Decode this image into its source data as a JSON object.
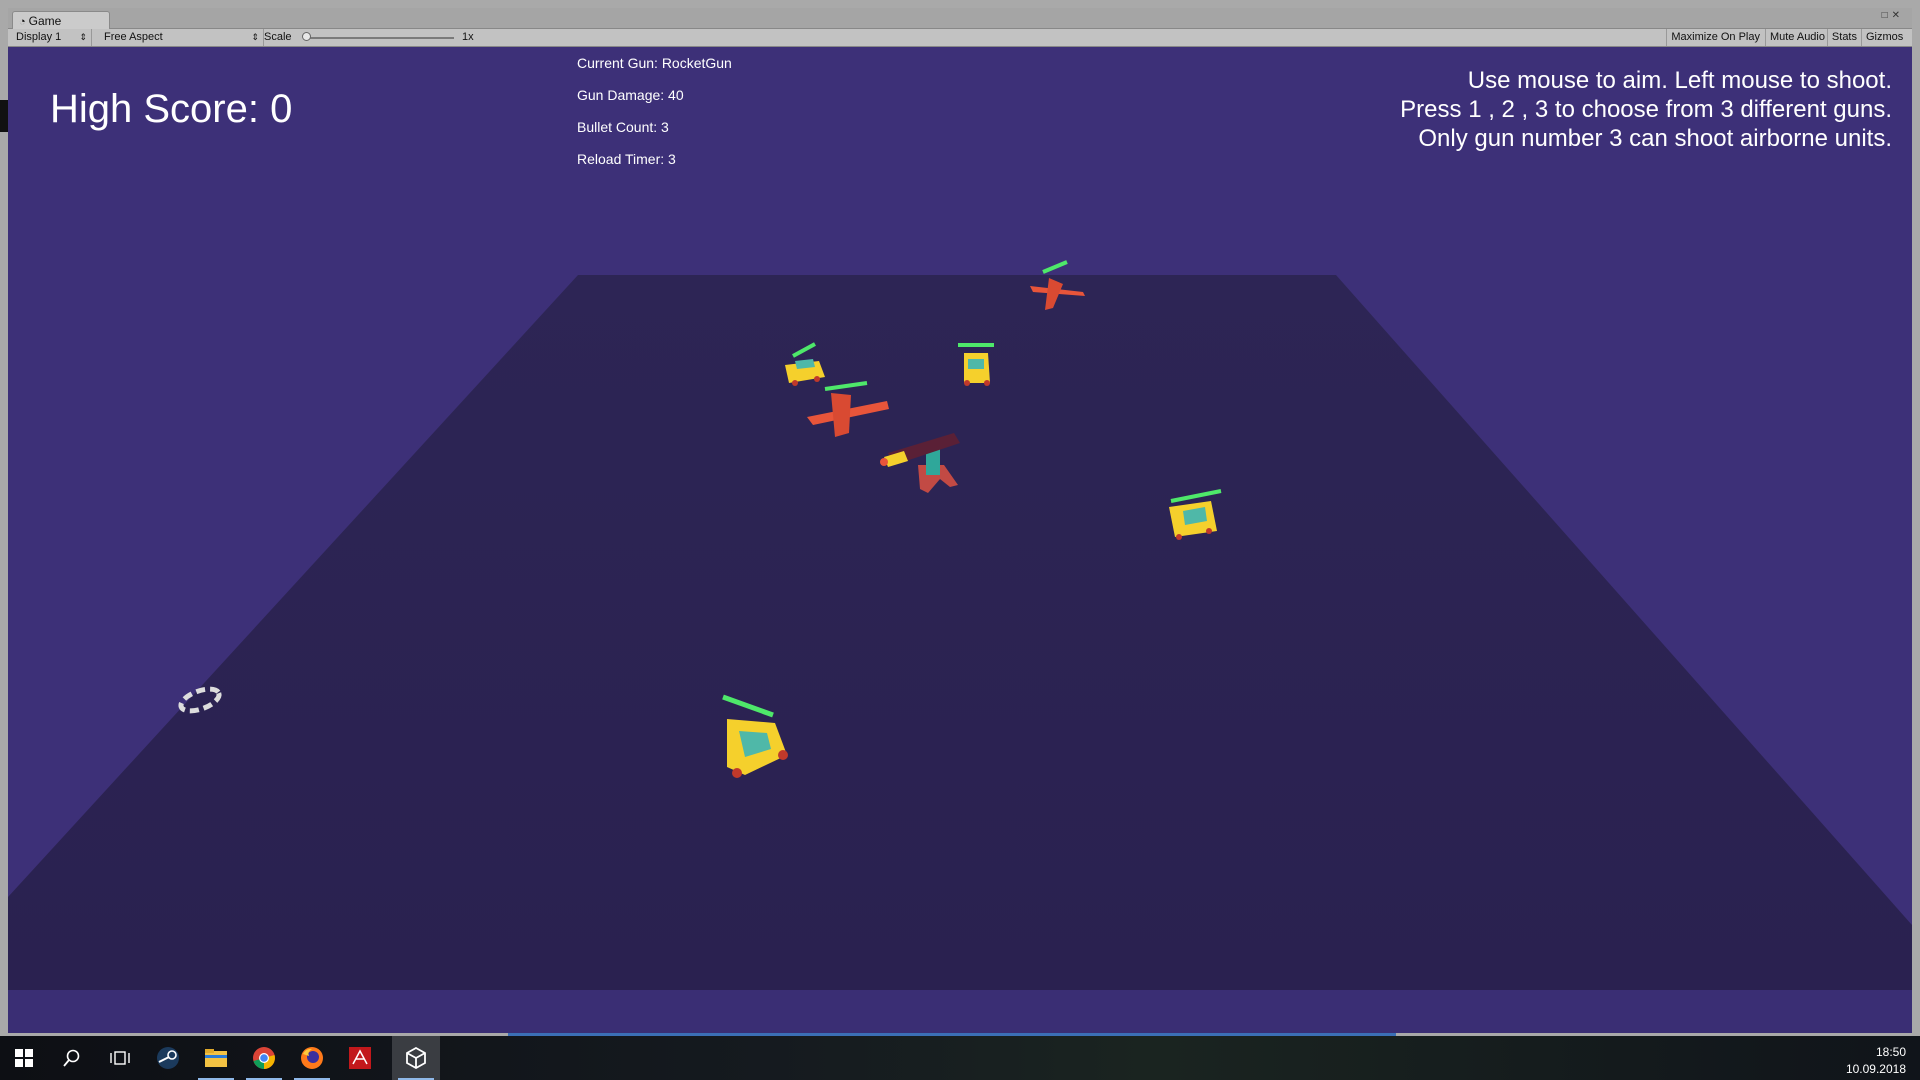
{
  "editor": {
    "tab_label": "Game",
    "tab_icon": "pacman-icon",
    "toolbar": {
      "display": "Display 1",
      "aspect": "Free Aspect",
      "scale_label": "Scale",
      "scale_value": "1x",
      "maximize_on_play": "Maximize On Play",
      "mute_audio": "Mute Audio",
      "stats": "Stats",
      "gizmos": "Gizmos"
    }
  },
  "hud": {
    "high_score": "High Score: 0",
    "current_gun": "Current Gun: RocketGun",
    "gun_damage": "Gun Damage: 40",
    "bullet_count": "Bullet Count: 3",
    "reload_timer": "Reload Timer: 3",
    "help": [
      "Use mouse to aim. Left mouse to shoot.",
      "Press 1 , 2 , 3 to choose from 3 different guns.",
      "Only gun number 3 can shoot airborne units."
    ]
  },
  "colors": {
    "sky": "#3d3078",
    "ground": "#2b2352",
    "car_body": "#f5d02c",
    "plane_body": "#e8553a",
    "health_bar": "#4ee86a",
    "window": "#4fb8a8"
  },
  "taskbar": {
    "icons": [
      "windows-start-icon",
      "search-icon",
      "task-view-icon",
      "steam-icon",
      "file-explorer-icon",
      "chrome-icon",
      "firefox-icon",
      "acrobat-icon",
      "unity-icon"
    ],
    "time": "18:50",
    "date": "10.09.2018"
  }
}
